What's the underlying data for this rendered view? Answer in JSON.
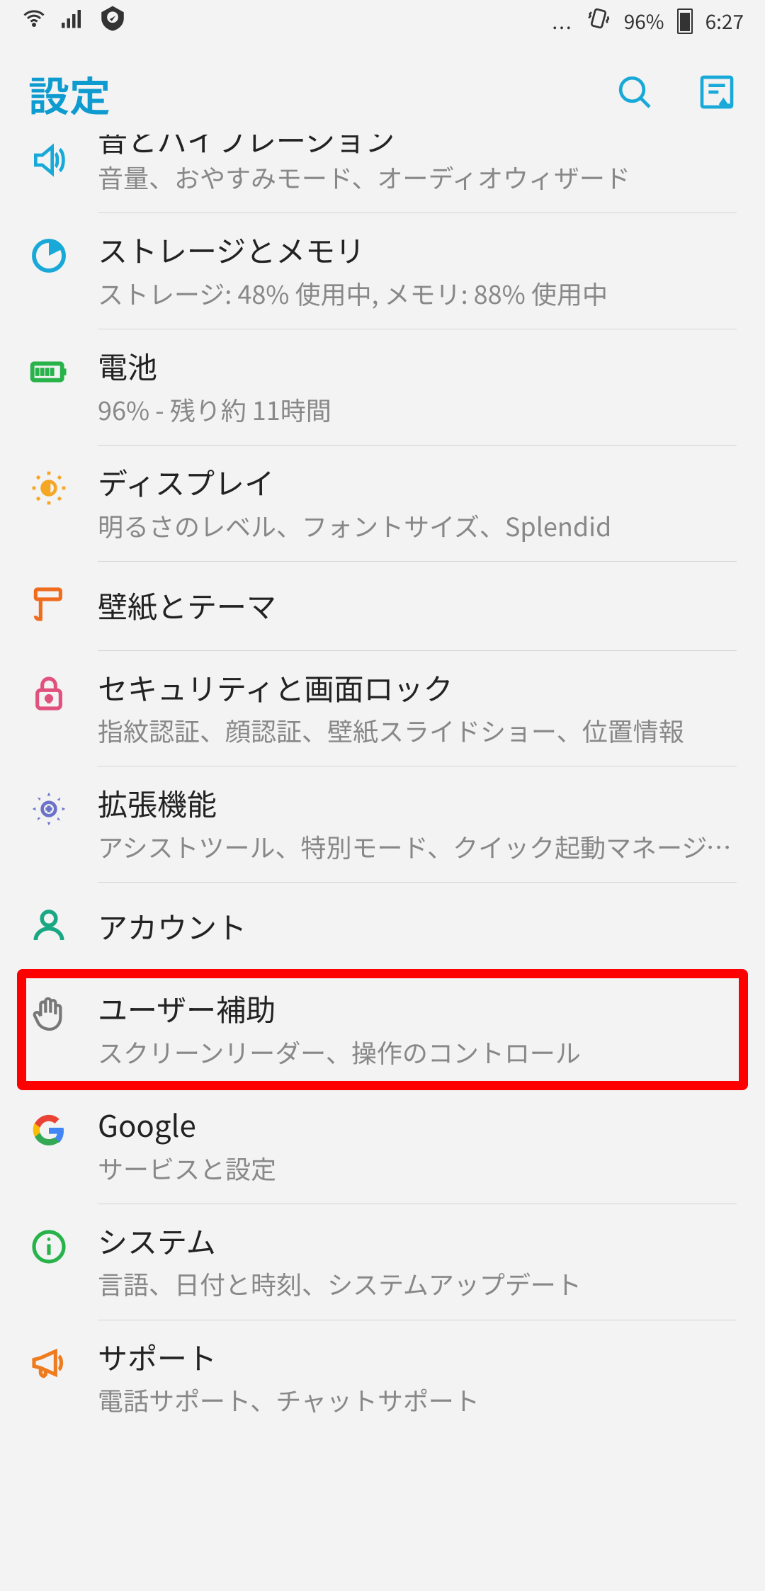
{
  "statusbar": {
    "dots": "...",
    "battery_percent": "96%",
    "time": "6:27"
  },
  "header": {
    "title": "設定"
  },
  "items": {
    "sound": {
      "title": "音とバイブレーション",
      "sub": "音量、おやすみモード、オーディオウィザード"
    },
    "storage": {
      "title": "ストレージとメモリ",
      "sub": "ストレージ: 48% 使用中, メモリ: 88% 使用中"
    },
    "battery": {
      "title": "電池",
      "sub": "96% - 残り約 11時間"
    },
    "display": {
      "title": "ディスプレイ",
      "sub": "明るさのレベル、フォントサイズ、Splendid"
    },
    "wall": {
      "title": "壁紙とテーマ"
    },
    "security": {
      "title": "セキュリティと画面ロック",
      "sub": "指紋認証、顔認証、壁紙スライドショー、位置情報"
    },
    "ext": {
      "title": "拡張機能",
      "sub": "アシストツール、特別モード、クイック起動マネージャー"
    },
    "account": {
      "title": "アカウント"
    },
    "access": {
      "title": "ユーザー補助",
      "sub": "スクリーンリーダー、操作のコントロール"
    },
    "google": {
      "title": "Google",
      "sub": "サービスと設定"
    },
    "system": {
      "title": "システム",
      "sub": "言語、日付と時刻、システムアップデート"
    },
    "support": {
      "title": "サポート",
      "sub": "電話サポート、チャットサポート"
    }
  }
}
